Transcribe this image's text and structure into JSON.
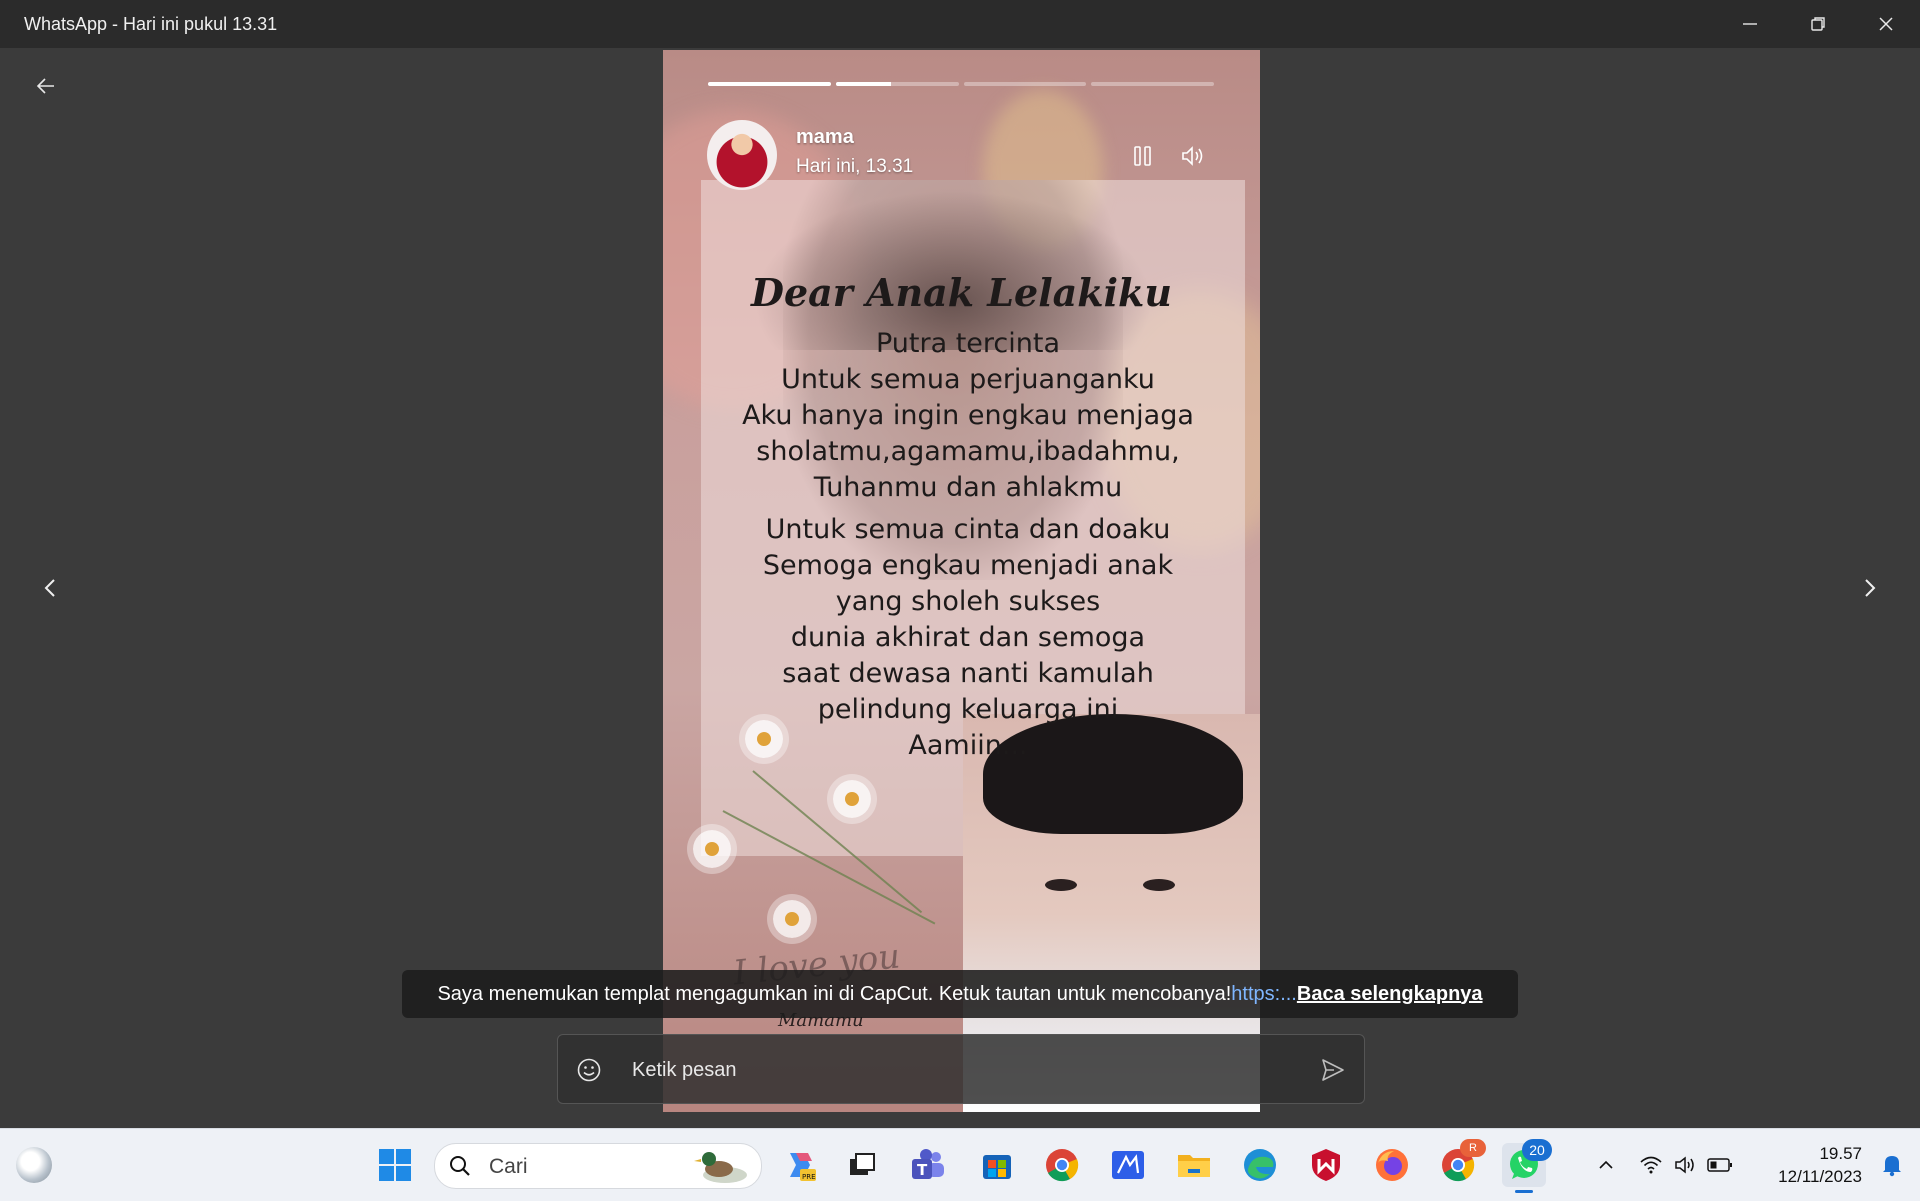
{
  "window": {
    "title": "WhatsApp - Hari ini pukul 13.31"
  },
  "story": {
    "progress": [
      1.0,
      0.45,
      0.0,
      0.0
    ],
    "contact_name": "mama",
    "timestamp": "Hari ini, 13.31",
    "title": "Dear Anak Lelakiku",
    "stanza1": [
      "Putra tercinta",
      "Untuk semua perjuanganku",
      "Aku hanya ingin engkau menjaga",
      "sholatmu,agamamu,ibadahmu,",
      "Tuhanmu dan ahlakmu"
    ],
    "stanza2": [
      "Untuk semua cinta dan doaku",
      "Semoga engkau menjadi anak",
      "yang sholeh sukses",
      "dunia akhirat dan semoga",
      "saat dewasa nanti kamulah",
      "pelindung keluarga ini",
      "Aamiin..."
    ],
    "signature": "I love you",
    "signature_name": "Mamamu"
  },
  "caption": {
    "text": "Saya menemukan templat mengagumkan ini di CapCut. Ketuk tautan untuk mencobanya! ",
    "link": "https:...",
    "read_more": "Baca selengkapnya"
  },
  "reply": {
    "placeholder": "Ketik pesan"
  },
  "taskbar": {
    "search_placeholder": "Cari",
    "whatsapp_badge": "20",
    "chrome_badge": "R",
    "time": "19.57",
    "date": "12/11/2023"
  },
  "colors": {
    "titlebar": "#2b2b2b",
    "viewer_bg": "#3b3b3b",
    "link": "#7fb6ff",
    "taskbar": "#eef1f6",
    "badge": "#1a6fd1"
  }
}
